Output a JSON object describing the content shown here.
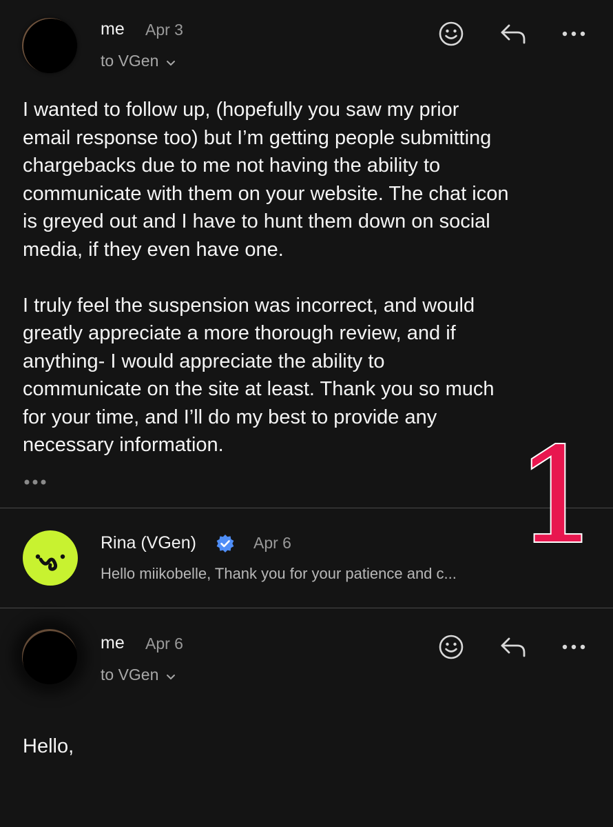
{
  "colors": {
    "background": "#141414",
    "text": "#f4f4f4",
    "muted": "#9a9a9a",
    "divider": "#4a4a4a",
    "vgen_brand": "#c8f230",
    "verified_badge": "#4f8ef7",
    "annotation": "#e8174f"
  },
  "messages": [
    {
      "sender": "me",
      "date": "Apr 3",
      "recipient": "to VGen",
      "body": "I wanted to follow up, (hopefully you saw my prior\nemail response too) but I’m getting people submitting\nchargebacks due to me not having the ability to\ncommunicate with them on your website. The chat icon\nis greyed out and I have to hunt them down on social\nmedia, if they even have one.\n\nI truly feel the suspension was incorrect, and would\ngreatly appreciate a more thorough review, and if\nanything- I would appreciate the ability to\ncommunicate on the site at least. Thank you so much\nfor your time, and I’ll do my best to provide any\nnecessary information."
    },
    {
      "sender": "Rina (VGen)",
      "date": "Apr 6",
      "snippet": "Hello miikobelle, Thank you for your patience and c..."
    },
    {
      "sender": "me",
      "date": "Apr 6",
      "recipient": "to VGen",
      "body": "Hello,"
    }
  ],
  "annotation": {
    "label": "1"
  },
  "icons": {
    "emoji_react": "smiley-icon",
    "reply": "reply-arrow-icon",
    "more": "more-dots-icon",
    "recipient_dropdown": "chevron-down-icon",
    "show_trimmed": "ellipsis-icon",
    "verified": "verified-badge-icon",
    "vgen_logo": "vgen-logo-icon"
  }
}
